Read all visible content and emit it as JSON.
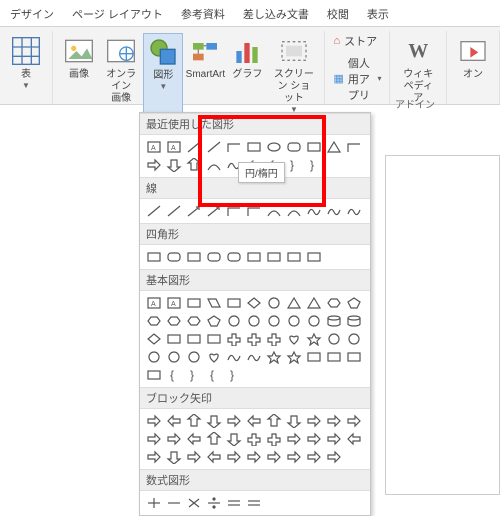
{
  "tabs": [
    "デザイン",
    "ページ レイアウト",
    "参考資料",
    "差し込み文書",
    "校閲",
    "表示"
  ],
  "ribbon": {
    "table": "表",
    "image": "画像",
    "online_image": "オンライン\n画像",
    "shapes": "図形",
    "smartart": "SmartArt",
    "chart": "グラフ",
    "screenshot": "スクリーン\nショット",
    "store": "ストア",
    "myapps": "個人用アプリ",
    "addins": "アドイン",
    "wiki": "ウィキ\nペディア",
    "online": "オン"
  },
  "categories": {
    "recent": "最近使用した図形",
    "lines": "線",
    "rectangles": "四角形",
    "basic": "基本図形",
    "arrows": "ブロック矢印",
    "equation": "数式図形"
  },
  "tooltip": "円/楕円",
  "chart_data": null
}
